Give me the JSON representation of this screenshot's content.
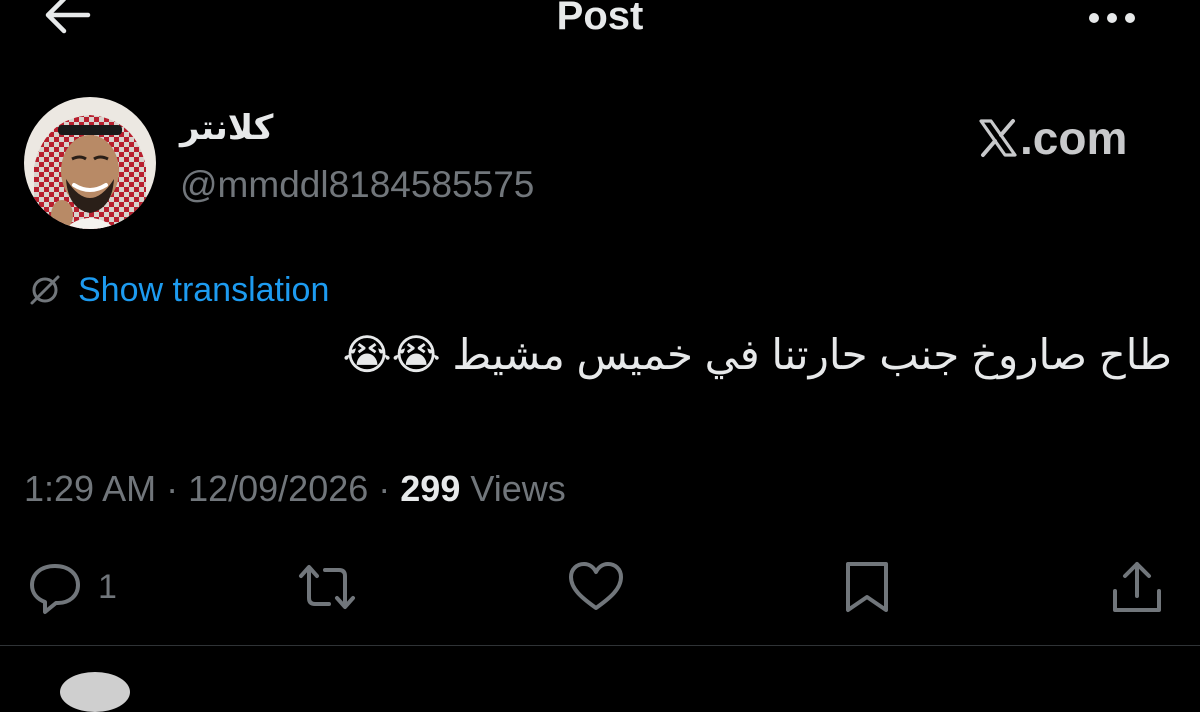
{
  "header": {
    "title": "Post",
    "back_icon": "arrow-left-icon",
    "more_icon": "more-horizontal-icon"
  },
  "author": {
    "display_name": "كلانتر",
    "handle": "@mmddl8184585575",
    "avatar": "avatar-photo"
  },
  "watermark": {
    "text": ".com",
    "logo_icon": "x-logo-icon"
  },
  "translation": {
    "icon": "globe-slash-icon",
    "link_text": "Show translation"
  },
  "tweet": {
    "text": "طاح صاروخ جنب حارتنا في خميس مشيط 😭😭"
  },
  "meta": {
    "time": "1:29 AM",
    "separator": " · ",
    "date": "12/09/2026",
    "views_count": "299",
    "views_label": " Views"
  },
  "actions": {
    "reply_count": "1",
    "icons": [
      "reply-icon",
      "repost-icon",
      "like-icon",
      "bookmark-icon",
      "share-icon"
    ]
  },
  "colors": {
    "background": "#000000",
    "text_primary": "#e7e9ea",
    "text_secondary": "#71767b",
    "accent": "#1d9bf0",
    "divider": "#2f3336"
  }
}
